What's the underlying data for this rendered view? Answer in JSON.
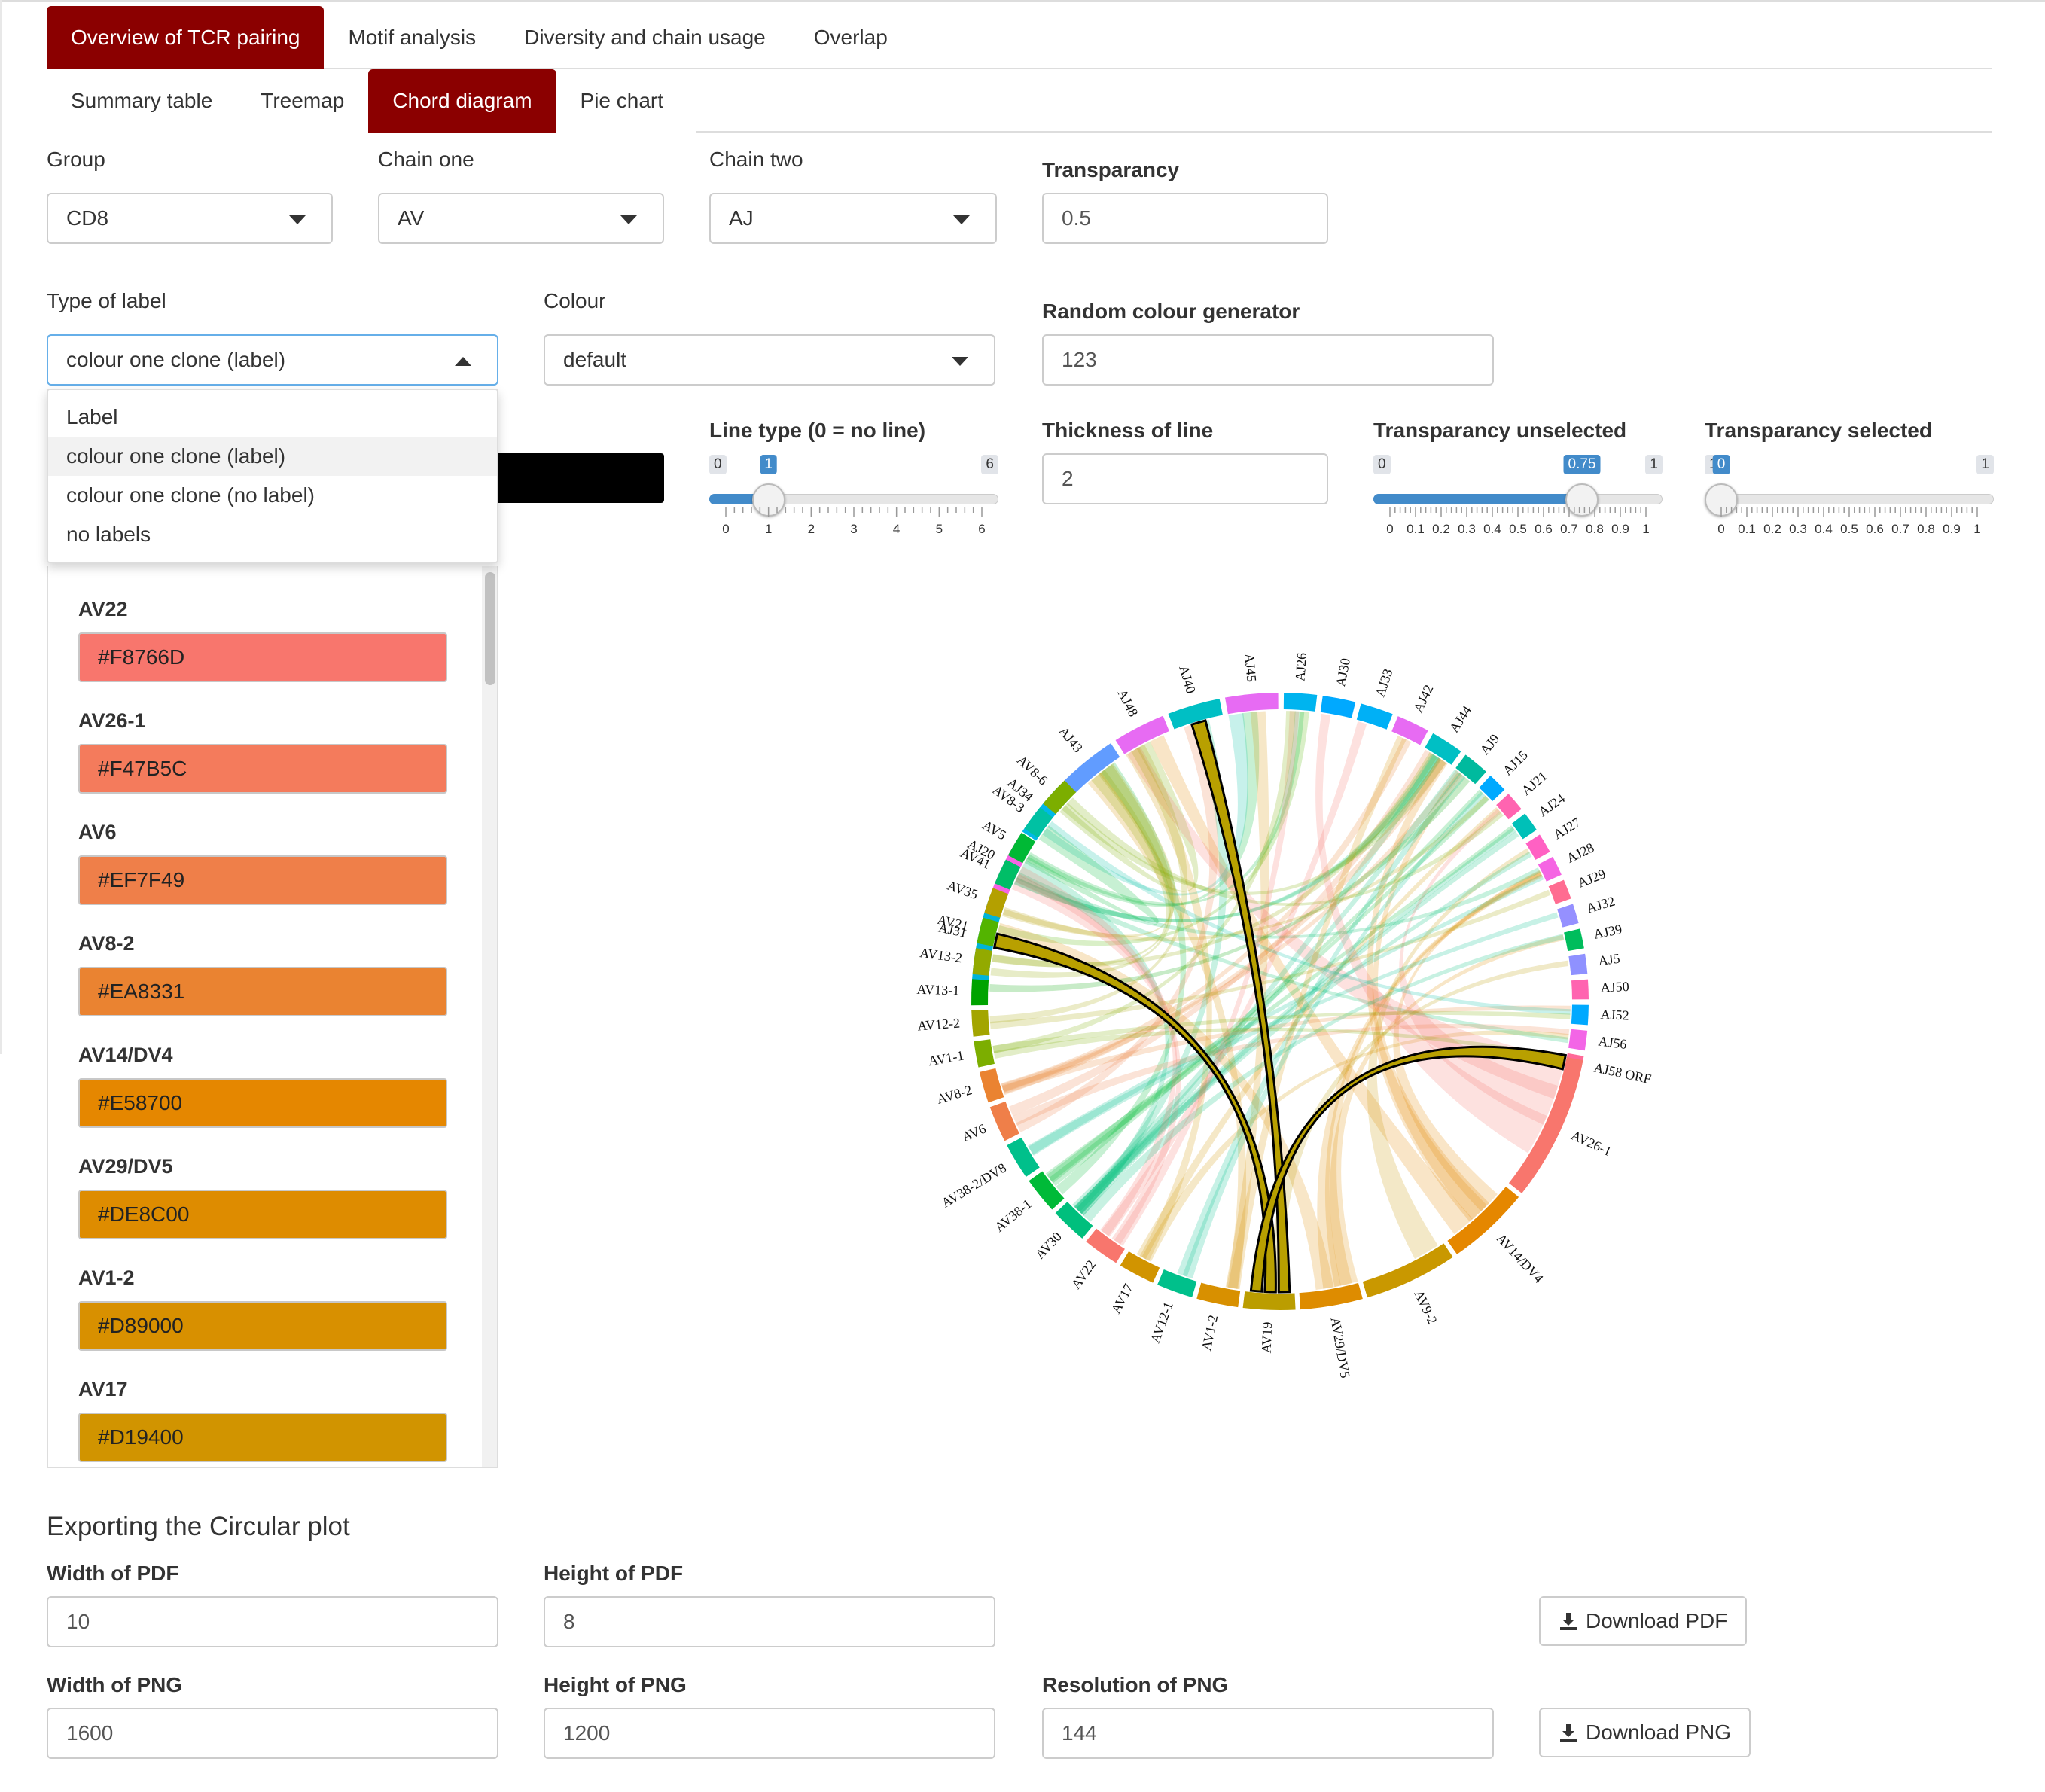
{
  "tabs_main": [
    {
      "label": "Overview of TCR pairing",
      "active": true
    },
    {
      "label": "Motif analysis",
      "active": false
    },
    {
      "label": "Diversity and chain usage",
      "active": false
    },
    {
      "label": "Overlap",
      "active": false
    }
  ],
  "tabs_sub": [
    {
      "label": "Summary table",
      "active": false
    },
    {
      "label": "Treemap",
      "active": false
    },
    {
      "label": "Chord diagram",
      "active": true
    },
    {
      "label": "Pie chart",
      "active": false
    }
  ],
  "controls": {
    "group_label": "Group",
    "group_value": "CD8",
    "chain_one_label": "Chain one",
    "chain_one_value": "AV",
    "chain_two_label": "Chain two",
    "chain_two_value": "AJ",
    "transparency_label": "Transparancy",
    "transparency_value": "0.5",
    "type_label": "Type of label",
    "type_value": "colour one clone (label)",
    "colour_label": "Colour",
    "colour_value": "default",
    "random_label": "Random colour generator",
    "random_value": "123",
    "thickness_label": "Thickness of line",
    "thickness_value": "2"
  },
  "type_options": [
    "Label",
    "colour one clone (label)",
    "colour one clone (no label)",
    "no labels"
  ],
  "sliders": [
    {
      "label": "Line type (0 = no line)",
      "min": 0,
      "max": 6,
      "value": 1,
      "min_text": "0",
      "max_text": "6",
      "value_text": "1",
      "ticks": [
        "0",
        "1",
        "2",
        "3",
        "4",
        "5",
        "6"
      ]
    },
    {
      "label": "Transparancy unselected",
      "min": 0,
      "max": 1,
      "value": 0.75,
      "min_text": "0",
      "max_text": "1",
      "value_text": "0.75",
      "ticks": [
        "0",
        "0.1",
        "0.2",
        "0.3",
        "0.4",
        "0.5",
        "0.6",
        "0.7",
        "0.8",
        "0.9",
        "1"
      ]
    },
    {
      "label": "Transparancy selected",
      "min": 0,
      "max": 1,
      "value": 0,
      "min_text": "1",
      "max_text": "1",
      "value_text": "0",
      "ticks": [
        "0",
        "0.1",
        "0.2",
        "0.3",
        "0.4",
        "0.5",
        "0.6",
        "0.7",
        "0.8",
        "0.9",
        "1"
      ]
    }
  ],
  "swatches": [
    {
      "name": "AV22",
      "hex": "#F8766D"
    },
    {
      "name": "AV26-1",
      "hex": "#F47B5C"
    },
    {
      "name": "AV6",
      "hex": "#EF7F49"
    },
    {
      "name": "AV8-2",
      "hex": "#EA8331"
    },
    {
      "name": "AV14/DV4",
      "hex": "#E58700"
    },
    {
      "name": "AV29/DV5",
      "hex": "#DE8C00"
    },
    {
      "name": "AV1-2",
      "hex": "#D89000"
    },
    {
      "name": "AV17",
      "hex": "#D19400"
    }
  ],
  "export": {
    "title": "Exporting the Circular plot",
    "width_pdf_label": "Width of PDF",
    "width_pdf_value": "10",
    "height_pdf_label": "Height of PDF",
    "height_pdf_value": "8",
    "download_pdf": "Download PDF",
    "width_png_label": "Width of PNG",
    "width_png_value": "1600",
    "height_png_label": "Height of PNG",
    "height_png_value": "1200",
    "res_png_label": "Resolution of PNG",
    "res_png_value": "144",
    "download_png": "Download PNG"
  },
  "chart_data": {
    "type": "chord",
    "sectors_top": [
      "AJ31",
      "AJ20",
      "AJ34",
      "AJ43",
      "AJ48",
      "AJ40",
      "AJ45",
      "AJ26",
      "AJ30",
      "AJ33",
      "AJ42",
      "AJ44",
      "AJ9",
      "AJ15",
      "AJ21",
      "AJ24",
      "AJ27",
      "AJ28",
      "AJ29",
      "AJ32",
      "AJ39",
      "AJ5",
      "AJ50",
      "AJ52",
      "AJ56",
      "AJ58 ORF"
    ],
    "sectors_bottom": [
      "AV26-1",
      "AV14/DV4",
      "AV9-2",
      "AV29/DV5",
      "AV19",
      "AV1-2",
      "AV12-1",
      "AV17",
      "AV22",
      "AV30",
      "AV38-1",
      "AV38-2/DV8",
      "AV6",
      "AV8-2",
      "AV1-1",
      "AV12-2",
      "AV13-1",
      "AV13-2",
      "AV21",
      "AV35",
      "AV41",
      "AV5",
      "AV8-3",
      "AV8-6"
    ],
    "sector_colors_top": [
      "#00B4D8",
      "#F564E3",
      "#00B8E7",
      "#619CFF",
      "#E76BF3",
      "#00BFC4",
      "#E76BF3",
      "#00B4EF",
      "#00A9FF",
      "#00B0F6",
      "#E76BF3",
      "#00BFC4",
      "#00BA9E",
      "#00A9FF",
      "#FF64B0",
      "#00C0B8",
      "#FF61C3",
      "#F564E3",
      "#FF6C91",
      "#9590FF",
      "#00BD5C",
      "#8F91FF",
      "#FF64B0",
      "#00A9FF",
      "#F365E6",
      "#FF6A98"
    ],
    "sector_colors_bottom": [
      "#F8766D",
      "#E58700",
      "#C99800",
      "#DE8C00",
      "#BB9D00",
      "#D89000",
      "#00C08B",
      "#D19400",
      "#F8766D",
      "#00BF7D",
      "#00BA38",
      "#00C08B",
      "#EF7F49",
      "#EA8331",
      "#7CAE00",
      "#A3A500",
      "#00A300",
      "#93AA00",
      "#53B400",
      "#B4A000",
      "#00BE67",
      "#00B935",
      "#00C1A3",
      "#7CAE00"
    ],
    "highlighted_links": [
      [
        "AJ40",
        "AV19"
      ],
      [
        "AJ31",
        "AV19"
      ],
      [
        "AJ58 ORF",
        "AV19"
      ]
    ]
  }
}
